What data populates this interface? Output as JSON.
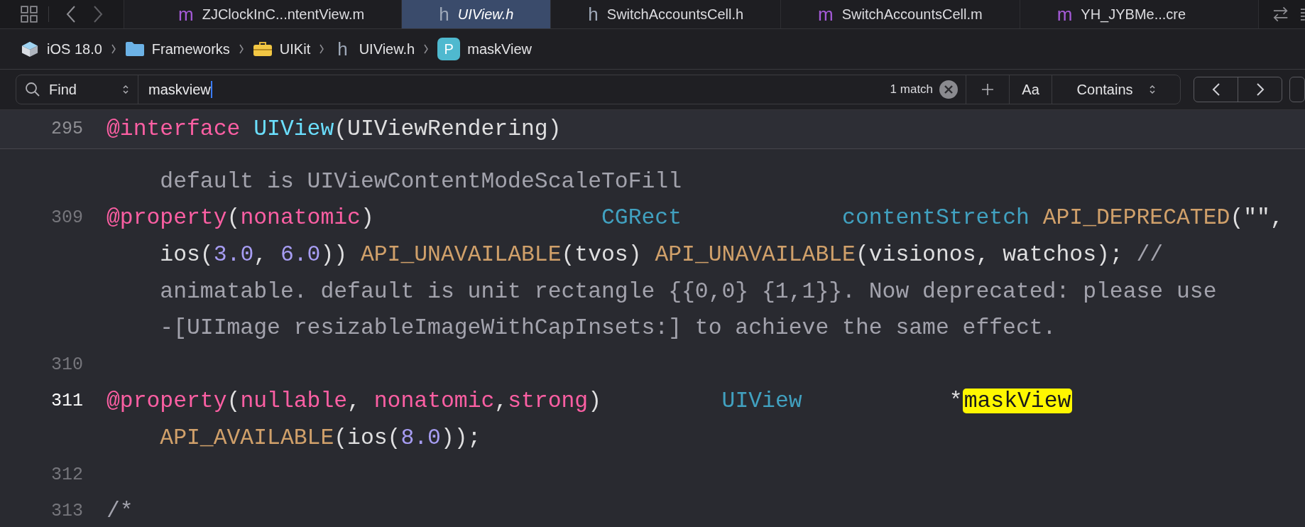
{
  "tabs": [
    {
      "kind": "source",
      "icon": "m",
      "label": "ZJClockInC...ntentView.m",
      "selected": false
    },
    {
      "kind": "header",
      "icon": "h",
      "label": "UIView.h",
      "selected": true
    },
    {
      "kind": "header",
      "icon": "h",
      "label": "SwitchAccountsCell.h",
      "selected": false
    },
    {
      "kind": "source",
      "icon": "m",
      "label": "SwitchAccountsCell.m",
      "selected": false
    },
    {
      "kind": "source",
      "icon": "m",
      "label": "YH_JYBMe...cre",
      "selected": false
    }
  ],
  "breadcrumb": [
    {
      "kind": "sdk",
      "label": "iOS 18.0"
    },
    {
      "kind": "folder",
      "label": "Frameworks"
    },
    {
      "kind": "toolbox",
      "label": "UIKit"
    },
    {
      "kind": "header",
      "icon": "h",
      "label": "UIView.h"
    },
    {
      "kind": "property",
      "icon": "P",
      "label": "maskView"
    }
  ],
  "find_bar": {
    "mode": "Find",
    "query": "maskview",
    "match_count": "1 match",
    "case_button": "Aa",
    "match_type": "Contains"
  },
  "editor": {
    "sticky_header": {
      "number": "295",
      "tokens": [
        {
          "kind": "keyword",
          "text": "@interface "
        },
        {
          "kind": "class",
          "text": "UIView"
        },
        {
          "kind": "plain",
          "text": "(UIViewRendering)"
        }
      ]
    },
    "lines": [
      {
        "rows": [
          {
            "tokens": [
              {
                "kind": "comment",
                "text": "default is UIViewContentModeScaleToFill"
              }
            ]
          }
        ]
      },
      {
        "number": "309",
        "current": false,
        "rows": [
          {
            "tokens": [
              {
                "kind": "keyword",
                "text": "@property"
              },
              {
                "kind": "plain",
                "text": "("
              },
              {
                "kind": "keyword",
                "text": "nonatomic"
              },
              {
                "kind": "plain",
                "text": ")                 "
              },
              {
                "kind": "type",
                "text": "CGRect            "
              },
              {
                "kind": "type",
                "text": "contentStretch "
              },
              {
                "kind": "macro",
                "text": "API_DEPRECATED"
              },
              {
                "kind": "plain",
                "text": "(\"\","
              }
            ]
          },
          {
            "tokens": [
              {
                "kind": "plain",
                "text": "ios("
              },
              {
                "kind": "number",
                "text": "3.0"
              },
              {
                "kind": "plain",
                "text": ", "
              },
              {
                "kind": "number",
                "text": "6.0"
              },
              {
                "kind": "plain",
                "text": ")) "
              },
              {
                "kind": "macro",
                "text": "API_UNAVAILABLE"
              },
              {
                "kind": "plain",
                "text": "(tvos) "
              },
              {
                "kind": "macro",
                "text": "API_UNAVAILABLE"
              },
              {
                "kind": "plain",
                "text": "(visionos, watchos); "
              },
              {
                "kind": "comment",
                "text": "//"
              }
            ]
          },
          {
            "tokens": [
              {
                "kind": "comment",
                "text": "animatable. default is unit rectangle {{0,0} {1,1}}. Now deprecated: please use"
              }
            ]
          },
          {
            "tokens": [
              {
                "kind": "comment",
                "text": "-[UIImage resizableImageWithCapInsets:] to achieve the same effect."
              }
            ]
          }
        ]
      },
      {
        "number": "310",
        "current": false,
        "rows": [
          {
            "tokens": []
          }
        ]
      },
      {
        "number": "311",
        "current": true,
        "rows": [
          {
            "tokens": [
              {
                "kind": "keyword",
                "text": "@property"
              },
              {
                "kind": "plain",
                "text": "("
              },
              {
                "kind": "keyword",
                "text": "nullable"
              },
              {
                "kind": "plain",
                "text": ", "
              },
              {
                "kind": "keyword",
                "text": "nonatomic"
              },
              {
                "kind": "plain",
                "text": ","
              },
              {
                "kind": "keyword",
                "text": "strong"
              },
              {
                "kind": "plain",
                "text": ")         "
              },
              {
                "kind": "type",
                "text": "UIView"
              },
              {
                "kind": "plain",
                "text": "           *"
              },
              {
                "kind": "match",
                "text": "maskView"
              }
            ]
          },
          {
            "tokens": [
              {
                "kind": "macro",
                "text": "API_AVAILABLE"
              },
              {
                "kind": "plain",
                "text": "(ios("
              },
              {
                "kind": "number",
                "text": "8.0"
              },
              {
                "kind": "plain",
                "text": "));"
              }
            ]
          }
        ]
      },
      {
        "number": "312",
        "current": false,
        "rows": [
          {
            "tokens": []
          }
        ]
      },
      {
        "number": "313",
        "current": false,
        "rows": [
          {
            "tokens": [
              {
                "kind": "comment",
                "text": "/*"
              }
            ]
          }
        ]
      }
    ]
  }
}
